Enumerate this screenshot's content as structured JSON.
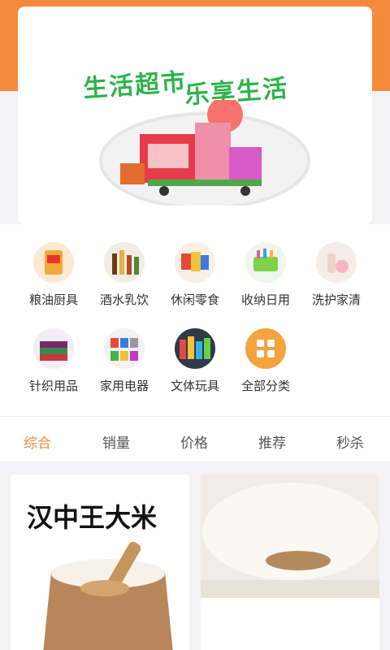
{
  "banner": {
    "slogan_line1": "生活超市",
    "slogan_line2": "乐享生活"
  },
  "categories": [
    {
      "label": "粮油厨具",
      "icon": "rice-bag-icon"
    },
    {
      "label": "酒水乳饮",
      "icon": "bottles-icon"
    },
    {
      "label": "休闲零食",
      "icon": "snacks-icon"
    },
    {
      "label": "收纳日用",
      "icon": "storage-icon"
    },
    {
      "label": "洗护家清",
      "icon": "cleaning-icon"
    },
    {
      "label": "针织用品",
      "icon": "towel-icon"
    },
    {
      "label": "家用电器",
      "icon": "appliance-icon"
    },
    {
      "label": "文体玩具",
      "icon": "toys-icon"
    },
    {
      "label": "全部分类",
      "icon": "grid-icon"
    }
  ],
  "sort_tabs": [
    "综合",
    "销量",
    "价格",
    "推荐",
    "秒杀"
  ],
  "products": [
    {
      "title": "汉中王大米"
    }
  ],
  "colors": {
    "accent": "#f38a3c",
    "green": "#2db34a"
  }
}
